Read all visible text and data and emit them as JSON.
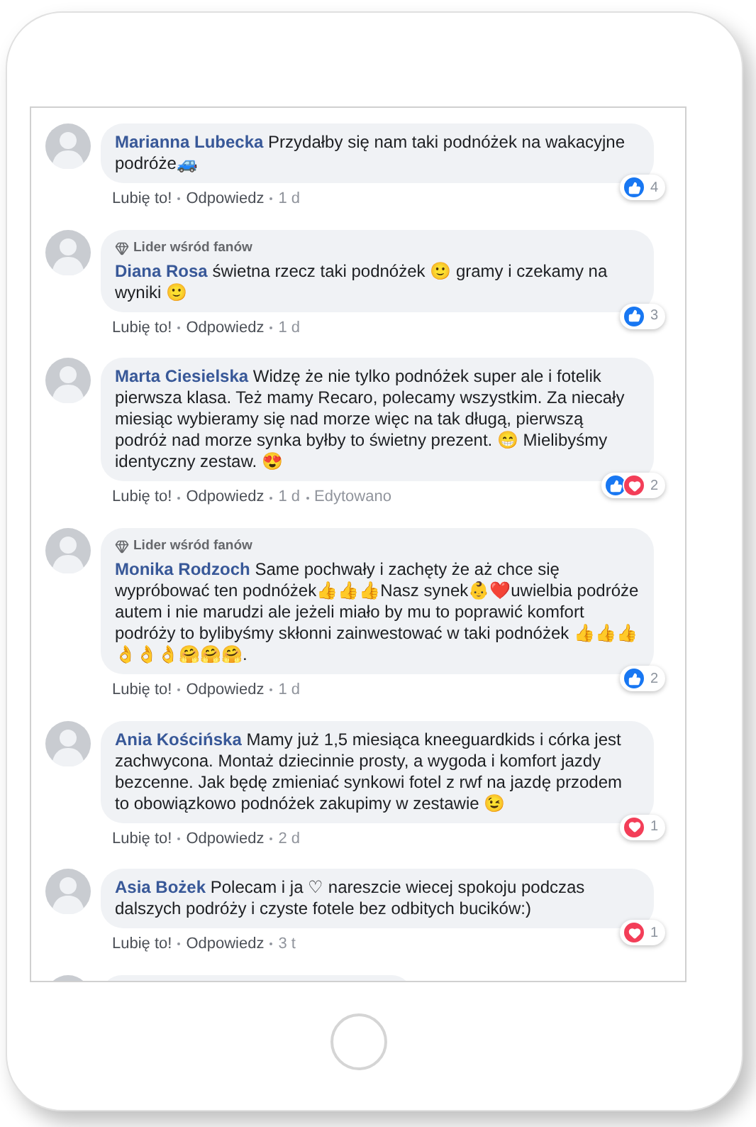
{
  "comments": [
    {
      "name": "Marianna Lubecka",
      "text": "Przydałby się nam taki podnóżek na wakacyjne podróże🚙",
      "actions": [
        "Lubię to!",
        "Odpowiedz",
        "1 d"
      ],
      "reactions": {
        "like": true,
        "love": false,
        "count": "4"
      }
    },
    {
      "badge": "Lider wśród fanów",
      "name": "Diana Rosa",
      "text": "świetna rzecz taki podnóżek 🙂 gramy i czekamy na wyniki 🙂",
      "actions": [
        "Lubię to!",
        "Odpowiedz",
        "1 d"
      ],
      "reactions": {
        "like": true,
        "love": false,
        "count": "3"
      }
    },
    {
      "name": "Marta Ciesielska",
      "text": "Widzę że nie tylko podnóżek super ale i fotelik pierwsza klasa. Też mamy Recaro, polecamy wszystkim. Za niecały miesiąc wybieramy się nad morze więc na tak długą, pierwszą podróż nad morze synka byłby to świetny prezent. 😁 Mielibyśmy identyczny zestaw. 😍",
      "actions": [
        "Lubię to!",
        "Odpowiedz",
        "1 d",
        "Edytowano"
      ],
      "reactions": {
        "like": true,
        "love": true,
        "count": "2"
      }
    },
    {
      "badge": "Lider wśród fanów",
      "name": "Monika Rodzoch",
      "text": "Same pochwały i zachęty że aż chce się wypróbować ten podnóżek👍👍👍Nasz synek👶❤️uwielbia podróże autem i nie marudzi ale jeżeli miało by mu to poprawić komfort podróży to bylibyśmy skłonni zainwestować w taki podnóżek 👍👍👍👌👌👌🤗🤗🤗.",
      "actions": [
        "Lubię to!",
        "Odpowiedz",
        "1 d"
      ],
      "reactions": {
        "like": true,
        "love": false,
        "count": "2"
      }
    },
    {
      "name": "Ania Kościńska",
      "text": "Mamy już 1,5 miesiąca kneeguardkids i córka jest zachwycona. Montaż dziecinnie prosty, a wygoda i komfort jazdy bezcenne. Jak będę zmieniać synkowi fotel z rwf na jazdę przodem to obowiązkowo podnóżek zakupimy w zestawie 😉",
      "actions": [
        "Lubię to!",
        "Odpowiedz",
        "2 d"
      ],
      "reactions": {
        "like": false,
        "love": true,
        "count": "1"
      }
    },
    {
      "name": "Asia Bożek",
      "text": "Polecam i ja ♡ nareszcie wiecej spokoju podczas dalszych podróży i czyste fotele bez odbitych bucików:)",
      "actions": [
        "Lubię to!",
        "Odpowiedz",
        "3 t"
      ],
      "reactions": {
        "like": false,
        "love": true,
        "count": "1"
      }
    }
  ]
}
